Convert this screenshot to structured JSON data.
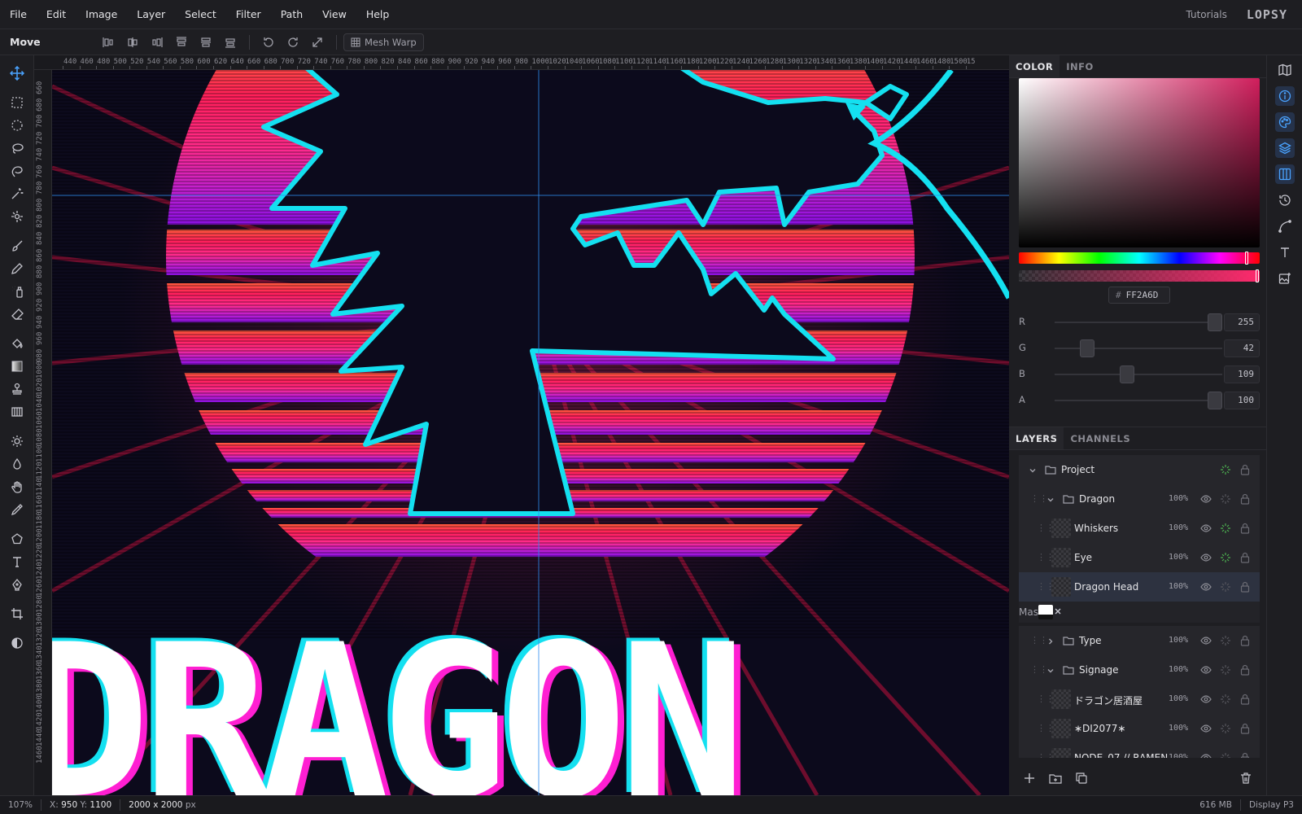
{
  "menu": [
    "File",
    "Edit",
    "Image",
    "Layer",
    "Select",
    "Filter",
    "Path",
    "View",
    "Help"
  ],
  "header": {
    "tutorials": "Tutorials",
    "logo": "LOPSY"
  },
  "options": {
    "tool": "Move",
    "mesh_warp": "Mesh Warp"
  },
  "ruler": {
    "top": [
      "440",
      "460",
      "480",
      "500",
      "520",
      "540",
      "560",
      "580",
      "600",
      "620",
      "640",
      "660",
      "680",
      "700",
      "720",
      "740",
      "760",
      "780",
      "800",
      "820",
      "840",
      "860",
      "880",
      "900",
      "920",
      "940",
      "960",
      "980",
      "1000",
      "1020",
      "1040",
      "1060",
      "1080",
      "1100",
      "1120",
      "1140",
      "1160",
      "1180",
      "1200",
      "1220",
      "1240",
      "1260",
      "1280",
      "1300",
      "1320",
      "1340",
      "1360",
      "1380",
      "1400",
      "1420",
      "1440",
      "1460",
      "1480",
      "1500",
      "15"
    ],
    "left": [
      "660",
      "680",
      "700",
      "720",
      "740",
      "760",
      "780",
      "800",
      "820",
      "840",
      "860",
      "880",
      "900",
      "920",
      "940",
      "960",
      "980",
      "1000",
      "1020",
      "1040",
      "1060",
      "1080",
      "1100",
      "1120",
      "1140",
      "1160",
      "1180",
      "1200",
      "1220",
      "1240",
      "1260",
      "1280",
      "1300",
      "1320",
      "1340",
      "1360",
      "1380",
      "1400",
      "1420",
      "1440",
      "1460"
    ]
  },
  "canvas": {
    "title_text": "DRAGON"
  },
  "color_panel": {
    "tabs": [
      "COLOR",
      "INFO"
    ],
    "hex_prefix": "#",
    "hex": "FF2A6D",
    "current_color": "#ff2a6d",
    "hue_position": 0.958,
    "alpha": 1.0,
    "channels": [
      {
        "label": "R",
        "value": "255",
        "fraction": 1.0
      },
      {
        "label": "G",
        "value": "42",
        "fraction": 0.165
      },
      {
        "label": "B",
        "value": "109",
        "fraction": 0.427
      },
      {
        "label": "A",
        "value": "100",
        "fraction": 1.0
      }
    ]
  },
  "layers_panel": {
    "tabs": [
      "LAYERS",
      "CHANNELS"
    ],
    "layers": [
      {
        "name": "Project",
        "kind": "group",
        "depth": 0,
        "expanded": true,
        "opacity": ""
      },
      {
        "name": "Dragon",
        "kind": "group",
        "depth": 1,
        "expanded": true,
        "opacity": "100%"
      },
      {
        "name": "Whiskers",
        "kind": "layer",
        "depth": 2,
        "opacity": "100%"
      },
      {
        "name": "Eye",
        "kind": "layer",
        "depth": 2,
        "opacity": "100%"
      },
      {
        "name": "Dragon Head",
        "kind": "layer",
        "depth": 2,
        "opacity": "100%",
        "selected": true
      },
      {
        "name": "Mask",
        "kind": "mask"
      },
      {
        "name": "Type",
        "kind": "group",
        "depth": 1,
        "expanded": false,
        "opacity": "100%"
      },
      {
        "name": "Signage",
        "kind": "group",
        "depth": 1,
        "expanded": true,
        "opacity": "100%"
      },
      {
        "name": "ドラゴン居酒屋",
        "kind": "layer",
        "depth": 2,
        "opacity": "100%"
      },
      {
        "name": "∗DI2077∗",
        "kind": "layer",
        "depth": 2,
        "opacity": "100%"
      },
      {
        "name": "NODE_07 // RAMEN",
        "kind": "layer",
        "depth": 2,
        "opacity": "100%"
      }
    ]
  },
  "status": {
    "zoom": "107%",
    "coords_x_label": "X:",
    "coords_x": "950",
    "coords_y_label": "Y:",
    "coords_y": "1100",
    "doc_size": "2000 x 2000",
    "doc_unit": "px",
    "memory": "616 MB",
    "color_profile": "Display P3"
  },
  "colors": {
    "accent": "#2d8cf0",
    "neon_cyan": "#14e0f0",
    "neon_pink": "#ff2a6d",
    "magenta": "#ff1fd2"
  }
}
